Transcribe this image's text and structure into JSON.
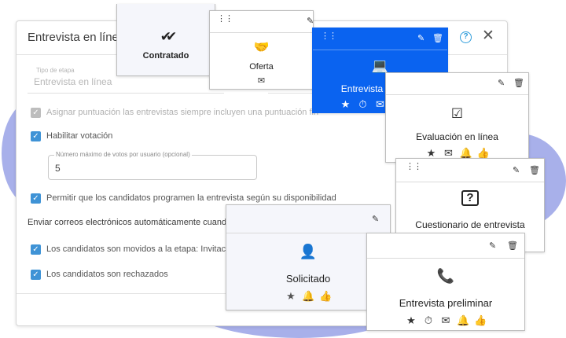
{
  "dialog": {
    "title": "Entrevista en línea",
    "help_icon": "help-circle-icon",
    "help_glyph": "?",
    "close_glyph": "✕",
    "stage_type_label": "Tipo de etapa",
    "stage_type_value": "Entrevista en línea",
    "options": {
      "score_option": "Asignar puntuación las entrevistas siempre incluyen una puntuación fin",
      "enable_voting": "Habilitar votación",
      "max_votes_label": "Número máximo de votos por usuario (opcional)",
      "max_votes_value": "5",
      "candidates_schedule": "Permitir que los candidatos programen la entrevista según su disponibilidad"
    },
    "email_section": {
      "title": "Enviar correos electrónicos automáticamente cuando",
      "moved_to_stage": "Los candidatos son movidos a la etapa: Invitació",
      "rejected": "Los candidatos son rechazados"
    }
  },
  "cards": {
    "contratado": {
      "title": "Contratado",
      "icon": "double-check-icon",
      "glyph": "✔✔"
    },
    "oferta": {
      "title": "Oferta",
      "icon": "handshake-icon",
      "glyph": "🤝",
      "actions": [
        "✉"
      ]
    },
    "entrevista_en_linea": {
      "title": "Entrevista en línea",
      "icon": "laptop-person-icon",
      "glyph": "💻",
      "actions": [
        "★",
        "⏱",
        "✉",
        "🔔",
        "👍"
      ]
    },
    "evaluacion_en_linea": {
      "title": "Evaluación en línea",
      "icon": "checklist-icon",
      "glyph": "☑",
      "actions": [
        "★",
        "✉",
        "🔔",
        "👍"
      ]
    },
    "cuestionario": {
      "title": "Cuestionario de entrevista",
      "icon": "question-bubble-icon",
      "glyph": "?"
    },
    "solicitado": {
      "title": "Solicitado",
      "icon": "person-arrow-icon",
      "glyph": "👤",
      "actions": [
        "★",
        "🔔",
        "👍"
      ]
    },
    "entrevista_preliminar": {
      "title": "Entrevista preliminar",
      "icon": "phone-icon",
      "glyph": "📞",
      "actions": [
        "★",
        "⏱",
        "✉",
        "🔔",
        "👍"
      ]
    }
  },
  "card_controls": {
    "drag": "⋮⋮",
    "edit": "✎",
    "delete": "🗑"
  },
  "check_glyph": "✓",
  "colors": {
    "accent_blue": "#0a63f0",
    "checkbox_blue": "#3f93d6",
    "blob": "#a8b0ea",
    "help_blue": "#2d9cdb"
  }
}
